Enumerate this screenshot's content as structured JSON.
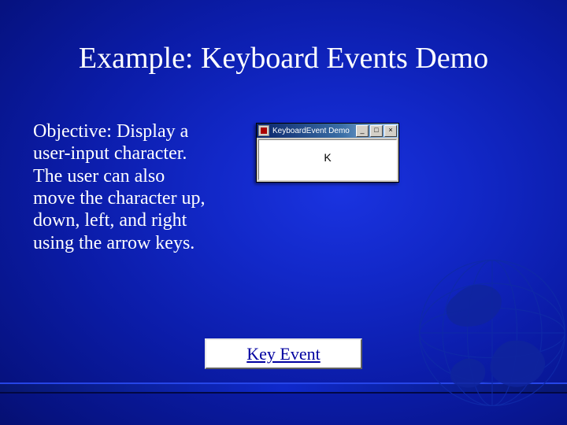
{
  "title": "Example: Keyboard Events Demo",
  "objective": "Objective: Display a user-input character. The user can also move the character up, down, left, and right using the arrow keys.",
  "window": {
    "title": "KeyboardEvent Demo",
    "character": "K",
    "buttons": {
      "min": "_",
      "max": "□",
      "close": "×"
    }
  },
  "button": {
    "label": "Key Event"
  }
}
